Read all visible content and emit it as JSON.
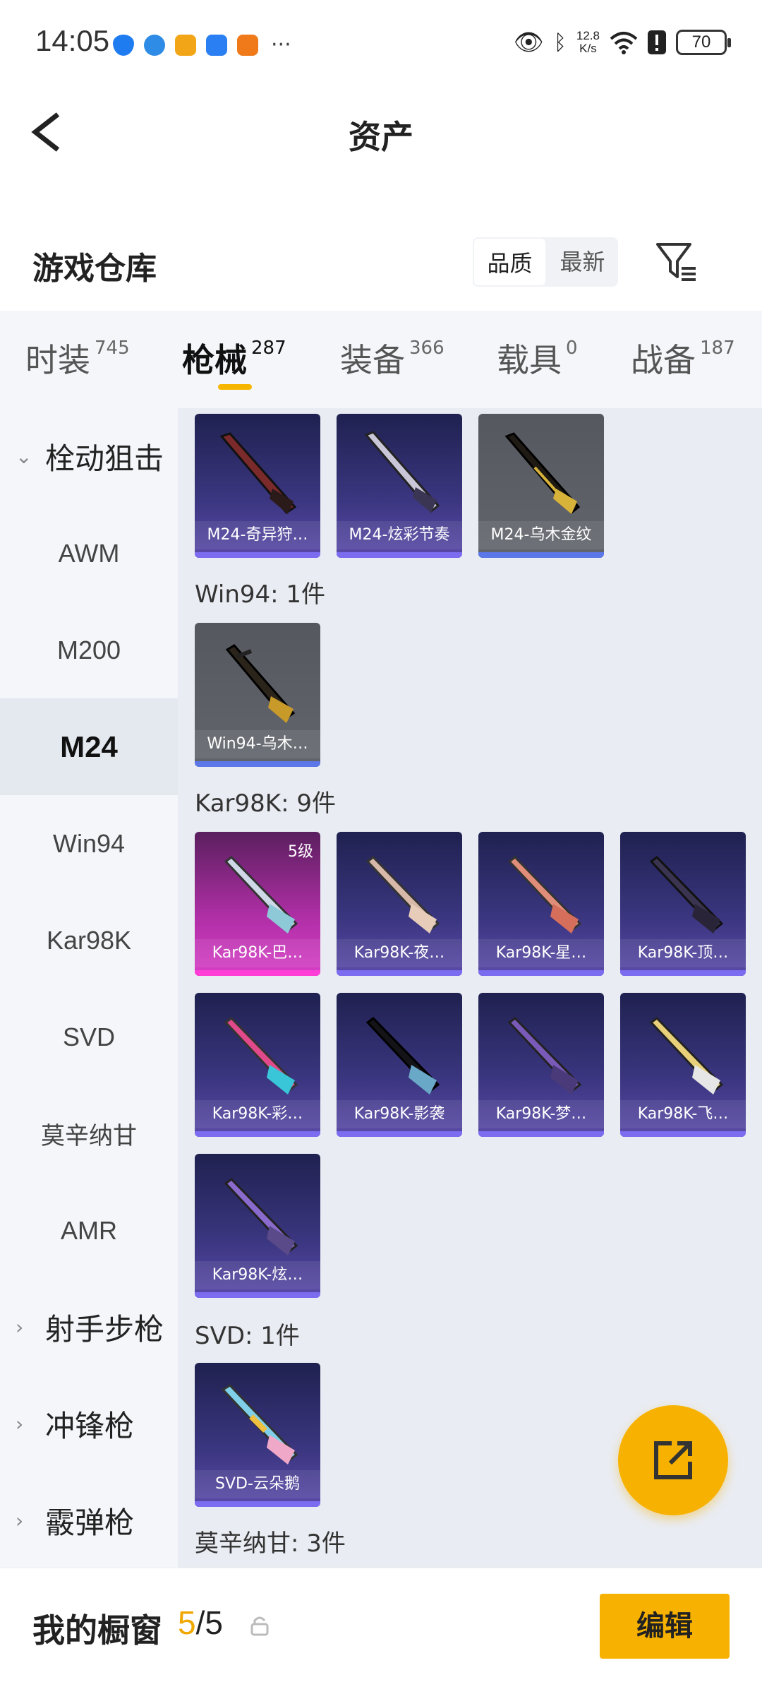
{
  "status_bar": {
    "time": "14:05",
    "more": "···",
    "speed_value": "12.8",
    "speed_unit": "K/s",
    "battery": "70"
  },
  "header": {
    "title": "资产"
  },
  "warehouse": {
    "title": "游戏仓库",
    "sort_options": [
      "品质",
      "最新"
    ],
    "active_sort": "品质"
  },
  "tabs": [
    {
      "label": "时装",
      "count": "745"
    },
    {
      "label": "枪械",
      "count": "287",
      "active": true
    },
    {
      "label": "装备",
      "count": "366"
    },
    {
      "label": "载具",
      "count": "0"
    },
    {
      "label": "战备",
      "count": "187"
    }
  ],
  "sidebar": {
    "items": [
      {
        "label": "栓动狙击",
        "type": "group",
        "expanded": true
      },
      {
        "label": "AWM"
      },
      {
        "label": "M200"
      },
      {
        "label": "M24",
        "active": true
      },
      {
        "label": "Win94"
      },
      {
        "label": "Kar98K"
      },
      {
        "label": "SVD"
      },
      {
        "label": "莫辛纳甘"
      },
      {
        "label": "AMR"
      },
      {
        "label": "射手步枪",
        "type": "group"
      },
      {
        "label": "冲锋枪",
        "type": "group"
      },
      {
        "label": "霰弹枪",
        "type": "group"
      }
    ]
  },
  "sections": {
    "m24_items": [
      {
        "name": "M24-奇异狩…",
        "rarity": "purple"
      },
      {
        "name": "M24-炫彩节奏",
        "rarity": "purple"
      },
      {
        "name": "M24-乌木金纹",
        "rarity": "grey"
      }
    ],
    "win94_label": "Win94: 1件",
    "win94_items": [
      {
        "name": "Win94-乌木…",
        "rarity": "grey"
      }
    ],
    "kar98k_label": "Kar98K: 9件",
    "kar98k_items": [
      {
        "name": "Kar98K-巴…",
        "rarity": "pink",
        "badge": "5级"
      },
      {
        "name": "Kar98K-夜…",
        "rarity": "purple"
      },
      {
        "name": "Kar98K-星…",
        "rarity": "purple"
      },
      {
        "name": "Kar98K-顶…",
        "rarity": "purple"
      },
      {
        "name": "Kar98K-彩…",
        "rarity": "purple"
      },
      {
        "name": "Kar98K-影袭",
        "rarity": "purple"
      },
      {
        "name": "Kar98K-梦…",
        "rarity": "purple"
      },
      {
        "name": "Kar98K-飞…",
        "rarity": "purple"
      },
      {
        "name": "Kar98K-炫…",
        "rarity": "purple"
      }
    ],
    "svd_label": "SVD: 1件",
    "svd_items": [
      {
        "name": "SVD-云朵鹅",
        "rarity": "purple"
      }
    ],
    "mosin_label": "莫辛纳甘: 3件"
  },
  "bottom_bar": {
    "title": "我的橱窗",
    "count_current": "5",
    "count_sep_total": "/5",
    "edit_label": "编辑"
  },
  "colors": {
    "accent": "#f7b100",
    "purple_card": "#3b3680",
    "pink_card": "#d63fc6",
    "grey_card": "#5f6268"
  }
}
